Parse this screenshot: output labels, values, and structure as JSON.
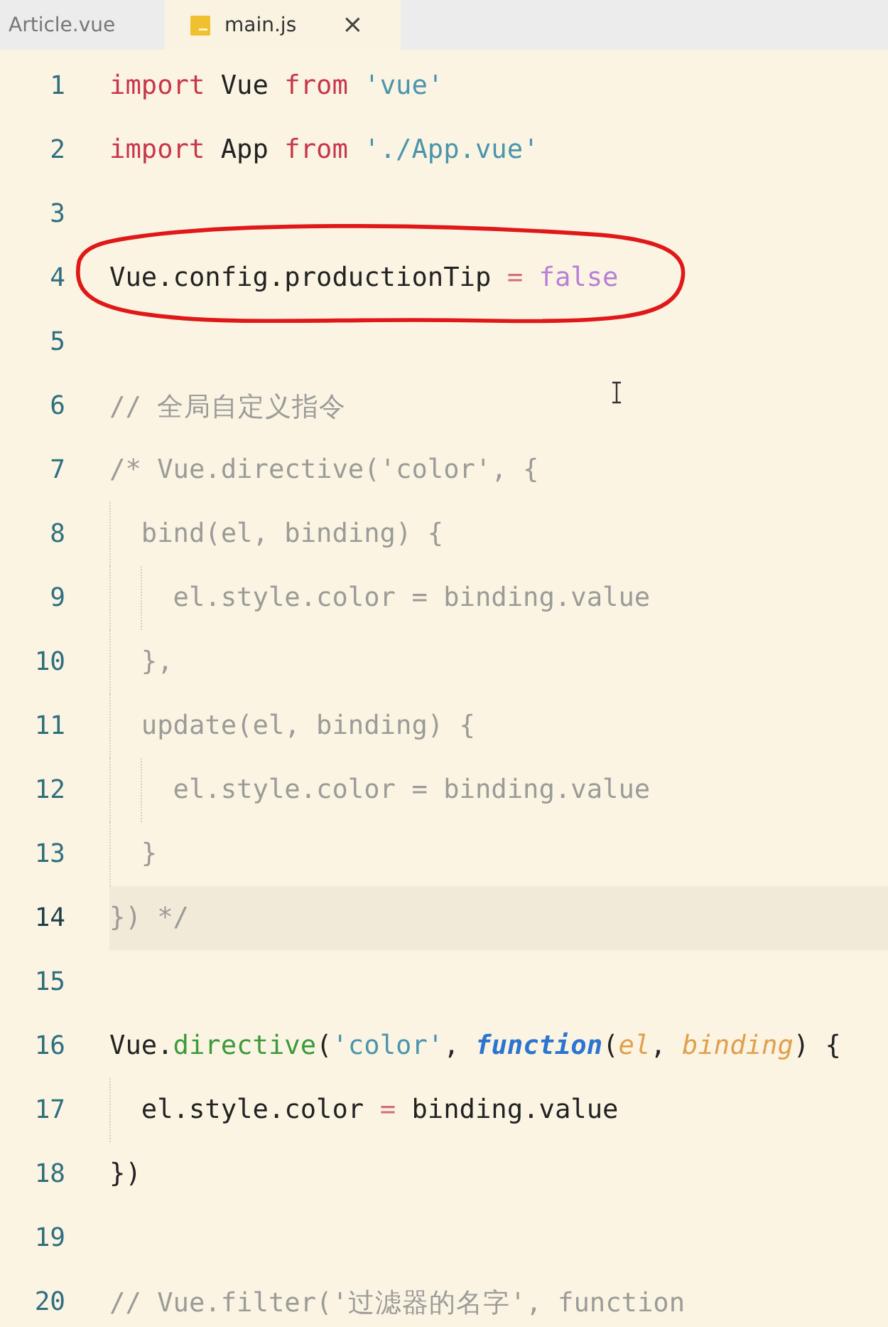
{
  "tabs": [
    {
      "label": "Article.vue",
      "selected": false
    },
    {
      "label": "main.js",
      "selected": true,
      "close": "×"
    }
  ],
  "lines": [
    {
      "number": "1",
      "current": false,
      "circled": false,
      "tokens": [
        {
          "kind": "keyword",
          "text": "import"
        },
        {
          "kind": "plain",
          "text": " Vue "
        },
        {
          "kind": "keyword",
          "text": "from"
        },
        {
          "kind": "string",
          "text": " 'vue'"
        }
      ]
    },
    {
      "number": "2",
      "current": false,
      "circled": false,
      "tokens": [
        {
          "kind": "keyword",
          "text": "import"
        },
        {
          "kind": "plain",
          "text": " App "
        },
        {
          "kind": "keyword",
          "text": "from"
        },
        {
          "kind": "string",
          "text": " './App.vue'"
        }
      ]
    },
    {
      "number": "3",
      "current": false,
      "circled": false
    },
    {
      "number": "4",
      "current": false,
      "circled": true,
      "tokens": [
        {
          "kind": "plain",
          "text": "Vue.config.productionTip "
        },
        {
          "kind": "operator",
          "text": "="
        },
        {
          "kind": "boolean",
          "text": " false"
        }
      ]
    },
    {
      "number": "5",
      "current": false,
      "circled": false
    },
    {
      "number": "6",
      "current": false,
      "circled": false,
      "tokens": [
        {
          "kind": "comment",
          "text": "// 全局自定义指令"
        }
      ]
    },
    {
      "number": "7",
      "current": false,
      "circled": false,
      "tokens": [
        {
          "kind": "comment",
          "text": "/* Vue.directive('color', {"
        }
      ]
    },
    {
      "number": "8",
      "current": false,
      "circled": false,
      "tokens": [
        {
          "kind": "comment",
          "text": "  bind(el, binding) {"
        }
      ]
    },
    {
      "number": "9",
      "current": false,
      "circled": false,
      "tokens": [
        {
          "kind": "comment",
          "text": "    el.style.color = binding.value"
        }
      ]
    },
    {
      "number": "10",
      "current": false,
      "circled": false,
      "tokens": [
        {
          "kind": "comment",
          "text": "  },"
        }
      ]
    },
    {
      "number": "11",
      "current": false,
      "circled": false,
      "tokens": [
        {
          "kind": "comment",
          "text": "  update(el, binding) {"
        }
      ]
    },
    {
      "number": "12",
      "current": false,
      "circled": false,
      "tokens": [
        {
          "kind": "comment",
          "text": "    el.style.color = binding.value"
        }
      ]
    },
    {
      "number": "13",
      "current": false,
      "circled": false,
      "tokens": [
        {
          "kind": "comment",
          "text": "  }"
        }
      ]
    },
    {
      "number": "14",
      "current": true,
      "circled": false,
      "tokens": [
        {
          "kind": "comment",
          "text": "}) */"
        }
      ]
    },
    {
      "number": "15",
      "current": false,
      "circled": false
    },
    {
      "number": "16",
      "current": false,
      "circled": false,
      "tokens": [
        {
          "kind": "plain",
          "text": "Vue."
        },
        {
          "kind": "method",
          "text": "directive"
        },
        {
          "kind": "plain",
          "text": "("
        },
        {
          "kind": "string",
          "text": "'color'"
        },
        {
          "kind": "plain",
          "text": ", "
        },
        {
          "kind": "function",
          "text": "function"
        },
        {
          "kind": "plain",
          "text": "("
        },
        {
          "kind": "param",
          "text": "el"
        },
        {
          "kind": "plain",
          "text": ", "
        },
        {
          "kind": "param",
          "text": "binding"
        },
        {
          "kind": "plain",
          "text": ") {"
        }
      ]
    },
    {
      "number": "17",
      "current": false,
      "circled": false,
      "tokens": [
        {
          "kind": "plain",
          "text": "  el.style.color "
        },
        {
          "kind": "operator",
          "text": "="
        },
        {
          "kind": "plain",
          "text": " binding.value"
        }
      ]
    },
    {
      "number": "18",
      "current": false,
      "circled": false,
      "tokens": [
        {
          "kind": "plain",
          "text": "})"
        }
      ]
    },
    {
      "number": "19",
      "current": false,
      "circled": false
    },
    {
      "number": "20",
      "current": false,
      "circled": false,
      "tokens": [
        {
          "kind": "comment",
          "text": "// Vue.filter('过滤器的名字', function"
        }
      ]
    }
  ]
}
